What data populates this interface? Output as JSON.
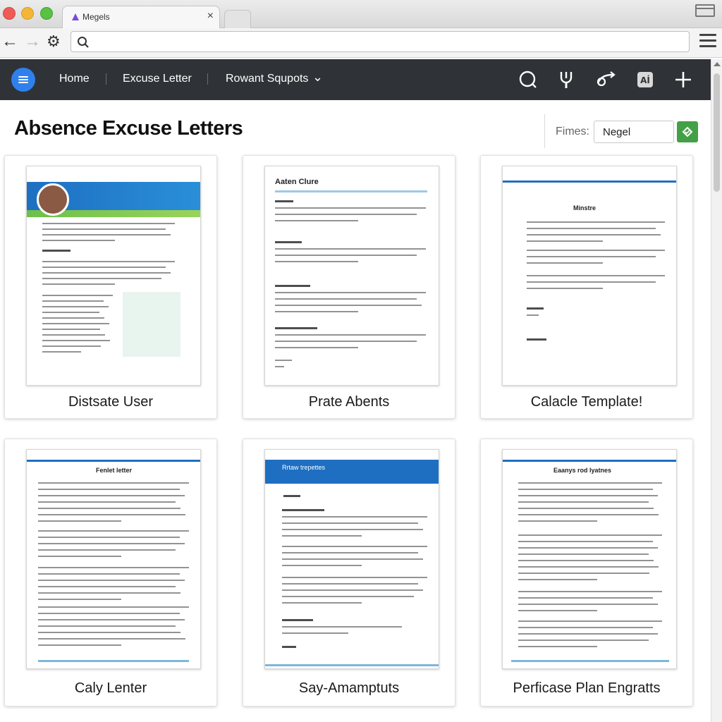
{
  "browser": {
    "tab_title": "Megels",
    "tab_close": "×"
  },
  "nav": {
    "links": [
      "Home",
      "Excuse Letter",
      "Rowant Squpots"
    ],
    "dropdown_caret": "⌄"
  },
  "page": {
    "title": "Absence Excuse Letters",
    "filter_label": "Fimes:",
    "filter_value": "Negel"
  },
  "templates": [
    {
      "label": "Distsate User",
      "doc_heading": ""
    },
    {
      "label": "Prate Abents",
      "doc_heading": "Aaten Clure"
    },
    {
      "label": "Calacle Template!",
      "doc_heading": "Minstre"
    },
    {
      "label": "Caly Lenter",
      "doc_heading": "Fenlet letter"
    },
    {
      "label": "Say-Amamptuts",
      "doc_heading": "Rrtaw trepettes"
    },
    {
      "label": "Perficase Plan Engratts",
      "doc_heading": "Eaanys rod lyatnes"
    }
  ],
  "colors": {
    "nav_bg": "#2f3337",
    "accent_blue": "#2f80ed",
    "go_green": "#43a047",
    "doc_blue": "#1e6fc2"
  }
}
